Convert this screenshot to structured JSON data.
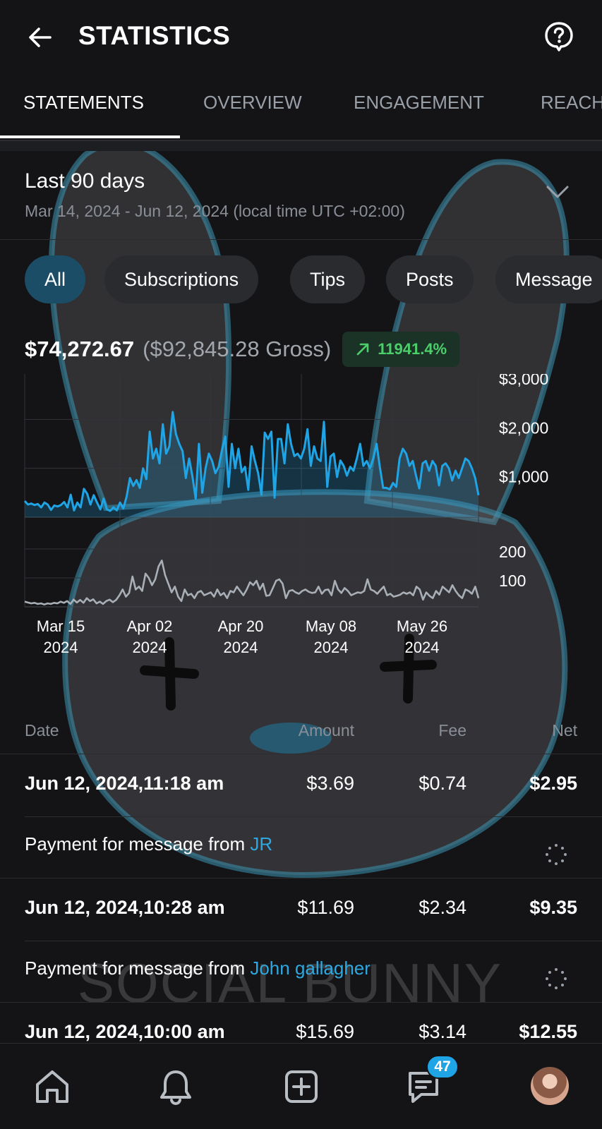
{
  "header": {
    "title": "STATISTICS",
    "back_icon": "arrow-left-icon",
    "help_icon": "help-circle-icon"
  },
  "tabs": [
    {
      "label": "STATEMENTS",
      "active": true
    },
    {
      "label": "OVERVIEW",
      "active": false
    },
    {
      "label": "ENGAGEMENT",
      "active": false
    },
    {
      "label": "REACH",
      "active": false
    }
  ],
  "period": {
    "title": "Last 90 days",
    "range": "Mar 14, 2024 - Jun 12, 2024 (local time UTC +02:00)"
  },
  "filters": [
    {
      "label": "All",
      "active": true
    },
    {
      "label": "Subscriptions",
      "active": false
    },
    {
      "label": "Tips",
      "active": false
    },
    {
      "label": "Posts",
      "active": false
    },
    {
      "label": "Message",
      "active": false
    }
  ],
  "totals": {
    "net": "$74,272.67",
    "gross": "($92,845.28 Gross)",
    "growth": "11941.4%"
  },
  "watermark": "SOCIAL BUNNY",
  "colors": {
    "accent": "#1fa5e6",
    "growth": "#4ccf6b",
    "background": "#141417",
    "secondary_series": "#a9afb6"
  },
  "chart_data": [
    {
      "type": "area",
      "x_start": "2024-03-14",
      "x_end": "2024-06-12",
      "y_tick_labels": [
        "$3,000",
        "$2,000",
        "$1,000"
      ],
      "ylim": [
        0,
        3000
      ],
      "series": [
        {
          "values": [
            330,
            260,
            280,
            250,
            270,
            200,
            300,
            260,
            150,
            240,
            220,
            250,
            310,
            200,
            460,
            140,
            300,
            200,
            580,
            480,
            260,
            450,
            300,
            160,
            380,
            160,
            130,
            200,
            140,
            300,
            180,
            420,
            800,
            640,
            760,
            600,
            1000,
            780,
            1750,
            1200,
            1400,
            1100,
            1900,
            1300,
            1450,
            2150,
            1700,
            1500,
            1350,
            800,
            1200,
            840,
            380,
            1500,
            500,
            1000,
            1300,
            1150,
            900,
            1030,
            1380,
            1650,
            620,
            1500,
            1000,
            1400,
            920,
            1030,
            560,
            1450,
            1150,
            900,
            460,
            1730,
            1600,
            1750,
            400,
            1600,
            1600,
            1100,
            1900,
            1500,
            1250,
            1300,
            1200,
            1400,
            1800,
            1050,
            1450,
            1200,
            1150,
            1950,
            620,
            1240,
            1300,
            820,
            1160,
            1050,
            850,
            1030,
            950,
            1200,
            1500,
            1050,
            1150,
            1000,
            1200,
            1500,
            1030,
            600,
            600,
            570,
            700,
            620,
            1200,
            1400,
            1300,
            1050,
            1150,
            850,
            590,
            1100,
            1150,
            950,
            1150,
            1050,
            650,
            1050,
            1100,
            1000,
            750,
            950,
            800,
            1000,
            1200,
            1150,
            1000,
            800,
            450
          ]
        }
      ]
    },
    {
      "type": "line",
      "x_tick_labels": [
        {
          "month": "Mar 15",
          "year": "2024"
        },
        {
          "month": "Apr 02",
          "year": "2024"
        },
        {
          "month": "Apr 20",
          "year": "2024"
        },
        {
          "month": "May 08",
          "year": "2024"
        },
        {
          "month": "May 26",
          "year": "2024"
        }
      ],
      "y_tick_labels": [
        "200",
        "100"
      ],
      "ylim": [
        0,
        200
      ],
      "series": [
        {
          "values": [
            18,
            15,
            12,
            14,
            10,
            12,
            8,
            12,
            10,
            14,
            12,
            18,
            14,
            20,
            10,
            25,
            15,
            24,
            14,
            30,
            20,
            26,
            12,
            18,
            10,
            20,
            25,
            16,
            24,
            40,
            60,
            35,
            48,
            105,
            60,
            70,
            55,
            115,
            100,
            75,
            95,
            140,
            160,
            110,
            80,
            50,
            70,
            35,
            20,
            60,
            40,
            45,
            30,
            50,
            55,
            40,
            45,
            50,
            35,
            60,
            40,
            48,
            30,
            55,
            50,
            70,
            55,
            40,
            60,
            85,
            75,
            90,
            60,
            80,
            38,
            40,
            65,
            90,
            95,
            80,
            30,
            55,
            58,
            50,
            45,
            55,
            60,
            52,
            48,
            50,
            70,
            45,
            58,
            60,
            40,
            90,
            60,
            48,
            65,
            55,
            40,
            45,
            50,
            48,
            55,
            95,
            60,
            55,
            45,
            58,
            70,
            40,
            45,
            35,
            38,
            42,
            50,
            45,
            50,
            40,
            70,
            60,
            25,
            50,
            38,
            30,
            55,
            42,
            70,
            60,
            50,
            75,
            55,
            40,
            30,
            60,
            55,
            45,
            70,
            30
          ]
        }
      ]
    }
  ],
  "table": {
    "headers": {
      "date": "Date",
      "amount": "Amount",
      "fee": "Fee",
      "net": "Net"
    },
    "rows": [
      {
        "date": "Jun 12, 2024,11:18 am",
        "amount": "$3.69",
        "fee": "$0.74",
        "net": "$2.95",
        "desc_prefix": "Payment for message from ",
        "user": "JR"
      },
      {
        "date": "Jun 12, 2024,10:28 am",
        "amount": "$11.69",
        "fee": "$2.34",
        "net": "$9.35",
        "desc_prefix": "Payment for message from ",
        "user": "John gallagher"
      },
      {
        "date": "Jun 12, 2024,10:00 am",
        "amount": "$15.69",
        "fee": "$3.14",
        "net": "$12.55",
        "desc_prefix": "",
        "user": ""
      }
    ]
  },
  "bottom_nav": {
    "items": [
      "home-icon",
      "bell-icon",
      "plus-square-icon",
      "messages-icon",
      "avatar"
    ],
    "messages_badge": "47"
  }
}
